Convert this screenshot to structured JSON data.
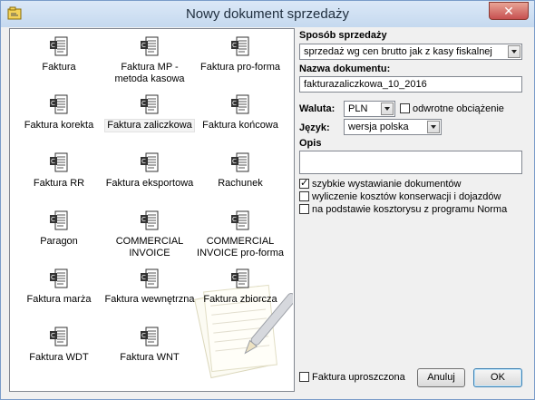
{
  "window": {
    "title": "Nowy dokument sprzedaży",
    "close_label": "✕"
  },
  "doc_types": [
    {
      "label": "Faktura"
    },
    {
      "label": "Faktura MP - metoda kasowa"
    },
    {
      "label": "Faktura pro-forma"
    },
    {
      "label": "Faktura korekta"
    },
    {
      "label": "Faktura zaliczkowa"
    },
    {
      "label": "Faktura końcowa"
    },
    {
      "label": "Faktura RR"
    },
    {
      "label": "Faktura eksportowa"
    },
    {
      "label": "Rachunek"
    },
    {
      "label": "Paragon"
    },
    {
      "label": "COMMERCIAL INVOICE"
    },
    {
      "label": "COMMERCIAL INVOICE pro-forma"
    },
    {
      "label": "Faktura marża"
    },
    {
      "label": "Faktura wewnętrzna"
    },
    {
      "label": "Faktura zbiorcza"
    },
    {
      "label": "Faktura WDT"
    },
    {
      "label": "Faktura WNT"
    }
  ],
  "selected_doc_type": "Faktura zaliczkowa",
  "form": {
    "sales_method_label": "Sposób sprzedaży",
    "sales_method_value": "sprzedaż wg cen brutto jak z kasy fiskalnej",
    "doc_name_label": "Nazwa dokumentu:",
    "doc_name_value": "fakturazaliczkowa_10_2016",
    "currency_label": "Waluta:",
    "currency_value": "PLN",
    "reverse_charge_label": "odwrotne obciążenie",
    "reverse_charge_checked": false,
    "language_label": "Język:",
    "language_value": "wersja polska",
    "description_label": "Opis",
    "description_value": "",
    "options": [
      {
        "label": "szybkie wystawianie dokumentów",
        "checked": true
      },
      {
        "label": "wyliczenie kosztów konserwacji i dojazdów",
        "checked": false
      },
      {
        "label": "na podstawie kosztorysu z programu Norma",
        "checked": false
      }
    ],
    "simplified_invoice_label": "Faktura uproszczona",
    "simplified_invoice_checked": false
  },
  "buttons": {
    "cancel_label": "Anuluj",
    "ok_label": "OK"
  },
  "colors": {
    "title_bar": "#c5d9ef",
    "close_button": "#c75050",
    "default_button_border": "#3c7fb1"
  }
}
